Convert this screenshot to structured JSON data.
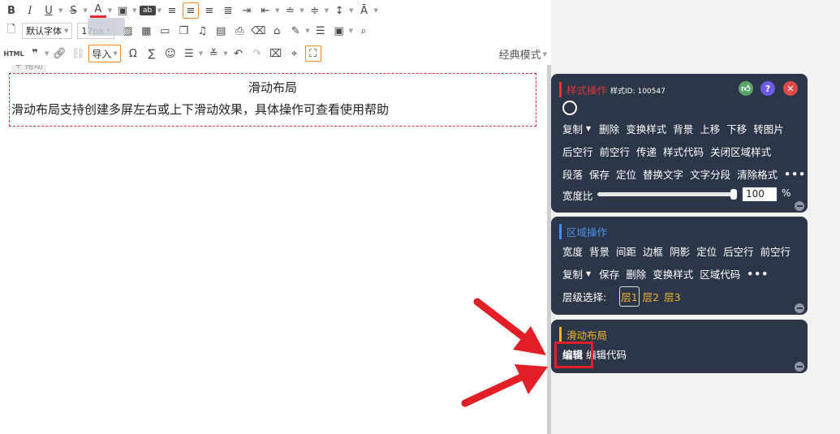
{
  "toolbar": {
    "font_family": "默认字体",
    "font_size": "17px",
    "import_label": "导入",
    "html_label": "HTML",
    "mode_label": "经典模式"
  },
  "editor": {
    "drag_hint": "+ 拖动",
    "block_title": "滑动布局",
    "block_text": "滑动布局支持创建多屏左右或上下滑动效果，具体操作可查看使用帮助"
  },
  "style_panel": {
    "title": "样式操作",
    "style_id": "样式ID: 100547",
    "row1": [
      "复制",
      "删除",
      "变换样式",
      "背景",
      "上移",
      "下移",
      "转图片"
    ],
    "row2": [
      "后空行",
      "前空行",
      "传递",
      "样式代码",
      "关闭区域样式"
    ],
    "row3": [
      "段落",
      "保存",
      "定位",
      "替换文字",
      "文字分段",
      "清除格式"
    ],
    "more": "•••",
    "width_label": "宽度比",
    "width_value": "100",
    "width_unit": "%"
  },
  "area_panel": {
    "title": "区域操作",
    "row1": [
      "宽度",
      "背景",
      "间距",
      "边框",
      "阴影",
      "定位",
      "后空行",
      "前空行"
    ],
    "row2": [
      "复制",
      "保存",
      "删除",
      "变换样式",
      "区域代码"
    ],
    "more": "•••",
    "level_label": "层级选择:",
    "levels": [
      "层1",
      "层2",
      "层3"
    ]
  },
  "slide_panel": {
    "title": "滑动布局",
    "edit_label": "编辑",
    "edit_code_label": "编辑代码"
  },
  "colors": {
    "panel_bg": "#2b3648",
    "highlight": "#e21e26",
    "accent_orange": "#f08f2a"
  }
}
